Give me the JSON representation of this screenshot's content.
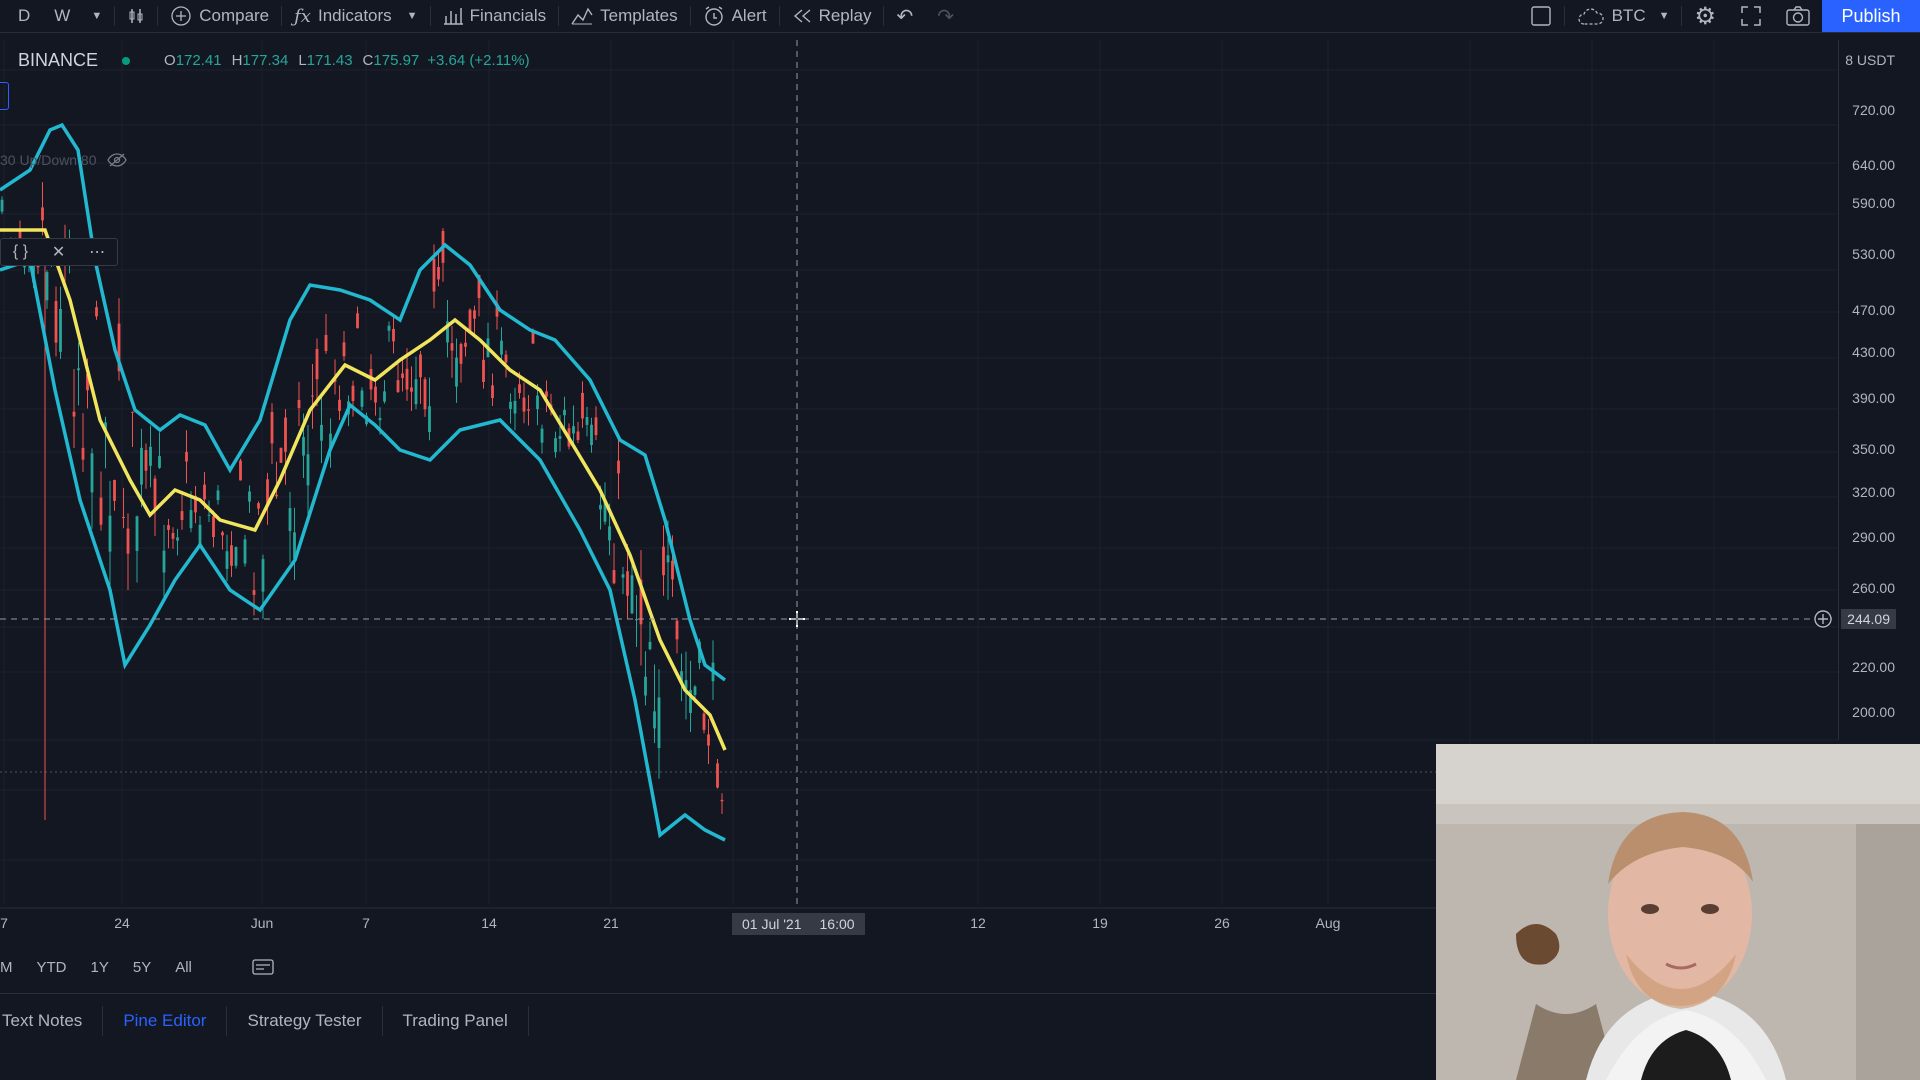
{
  "toolbar": {
    "intervals": [
      "D",
      "W"
    ],
    "compare": "Compare",
    "indicators": "Indicators",
    "financials": "Financials",
    "templates": "Templates",
    "alert": "Alert",
    "replay": "Replay",
    "currency": "BTC",
    "publish": "Publish"
  },
  "legend": {
    "exchange": "BINANCE",
    "open_label": "O",
    "open": "172.41",
    "high_label": "H",
    "high": "177.34",
    "low_label": "L",
    "low": "171.43",
    "close_label": "C",
    "close": "175.97",
    "change": "+3.64 (+2.11%)"
  },
  "indicator": {
    "label": "30 Up/Down 80"
  },
  "price_axis": {
    "currency": "8 USDT",
    "labels": [
      "720.00",
      "640.00",
      "590.00",
      "530.00",
      "470.00",
      "430.00",
      "390.00",
      "350.00",
      "320.00",
      "290.00",
      "260.00",
      "220.00",
      "200.00"
    ],
    "crosshair_price": "244.09"
  },
  "time_axis": {
    "labels": [
      "7",
      "24",
      "Jun",
      "7",
      "14",
      "21",
      "12",
      "19",
      "26",
      "Aug"
    ],
    "crosshair_date": "01 Jul '21",
    "crosshair_time": "16:00"
  },
  "ranges": [
    "M",
    "YTD",
    "1Y",
    "5Y",
    "All"
  ],
  "bottom_tabs": [
    "Text Notes",
    "Pine Editor",
    "Strategy Tester",
    "Trading Panel"
  ],
  "colors": {
    "background": "#131722",
    "bollinger": "#22b8cf",
    "basis": "#f0e55c",
    "up_candle": "#26a69a",
    "down_candle": "#ef5350",
    "accent": "#2962ff"
  }
}
